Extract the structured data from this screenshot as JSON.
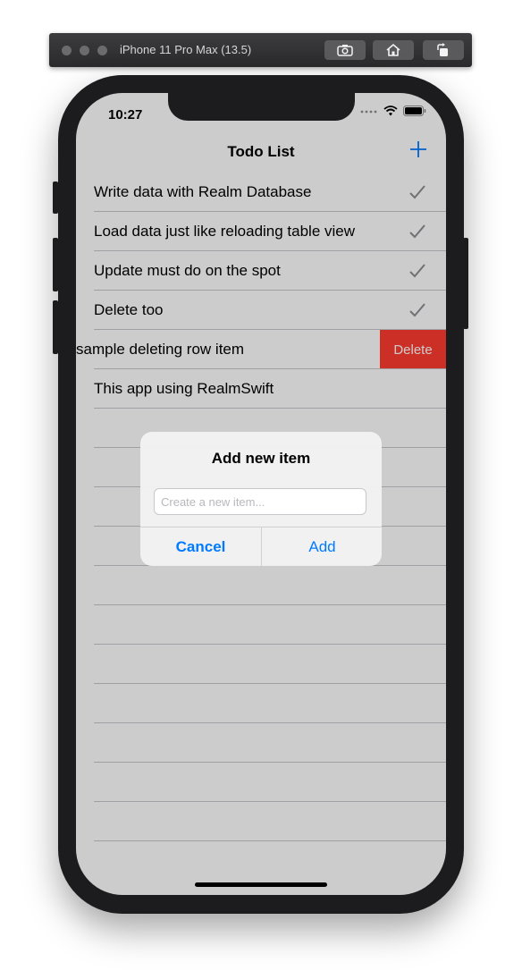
{
  "simulator": {
    "title": "iPhone 11 Pro Max (13.5)",
    "buttons": [
      "screenshot-icon",
      "home-icon",
      "rotate-icon"
    ]
  },
  "status_bar": {
    "time": "10:27"
  },
  "nav": {
    "title": "Todo List",
    "add_icon": "plus-icon"
  },
  "rows": [
    {
      "label": "Write data with Realm Database",
      "checked": true
    },
    {
      "label": "Load data just like reloading table view",
      "checked": true
    },
    {
      "label": "Update must do on the spot",
      "checked": true
    },
    {
      "label": "Delete too",
      "checked": true
    },
    {
      "label": "sample deleting row item",
      "swiped": true,
      "action": "Delete"
    },
    {
      "label": "This app using RealmSwift",
      "checked": false
    }
  ],
  "alert": {
    "title": "Add new item",
    "placeholder": "Create a new item...",
    "value": "",
    "cancel": "Cancel",
    "add": "Add"
  },
  "colors": {
    "accent": "#007aff",
    "destructive": "#ff3b30",
    "separator": "#c8c7cc"
  }
}
